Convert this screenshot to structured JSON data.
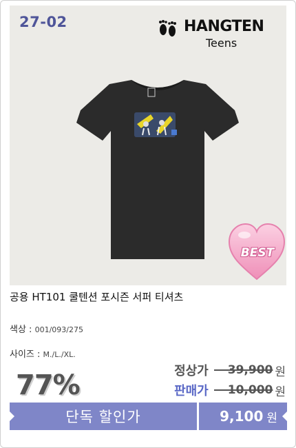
{
  "product": {
    "code": "27-02",
    "brand": {
      "name": "HANGTEN",
      "sub": "Teens"
    },
    "badge": "BEST",
    "title": "공용 HT101 쿨텐션 포시즌 서퍼 티셔츠",
    "color_label": "색상 :",
    "color_value": "001/093/275",
    "size_label": "사이즈 :",
    "size_value": "M./L./XL.",
    "discount": "77%",
    "regular_label": "정상가",
    "regular_price": "39,900",
    "sale_label": "판매가",
    "sale_price": "10,000",
    "won": "원",
    "promo_label": "단독 할인가",
    "promo_price": "9,100",
    "promo_won": "원"
  },
  "colors": {
    "accent": "#7f86c8",
    "code": "#4f5599",
    "sale_label": "#5a68c6",
    "shirt": "#2b2b2b",
    "badge": "#f3a9c9"
  }
}
